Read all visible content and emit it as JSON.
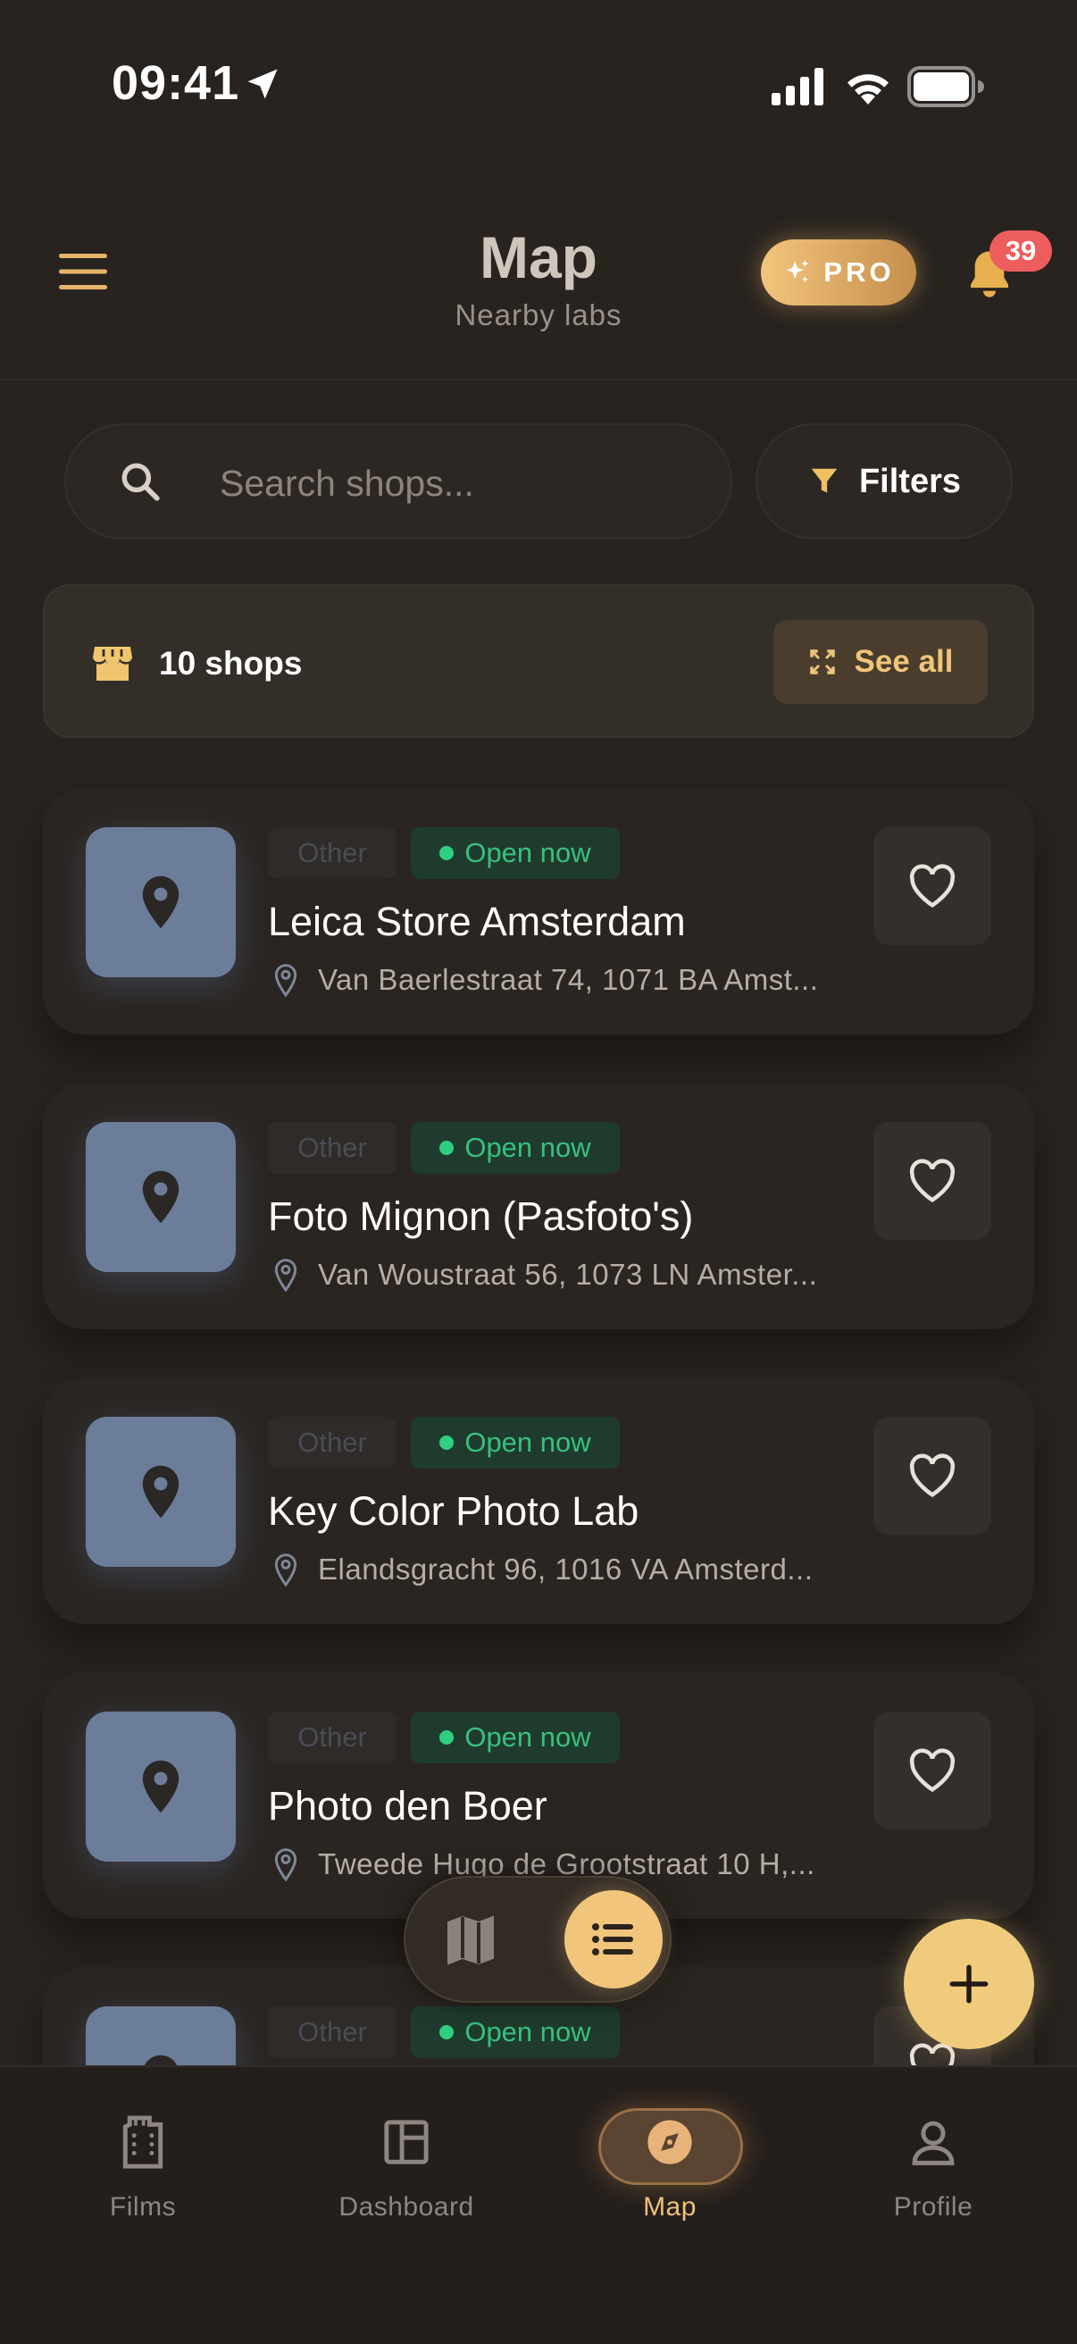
{
  "status_bar": {
    "time": "09:41"
  },
  "header": {
    "title": "Map",
    "subtitle": "Nearby labs",
    "pro_label": "PRO",
    "notification_count": "39"
  },
  "search": {
    "placeholder": "Search shops...",
    "value": ""
  },
  "filters_label": "Filters",
  "summary": {
    "count_label": "10 shops",
    "see_all_label": "See all"
  },
  "shops": [
    {
      "category": "Other",
      "status": "Open now",
      "name": "Leica Store Amsterdam",
      "address": "Van Baerlestraat 74, 1071 BA Amst..."
    },
    {
      "category": "Other",
      "status": "Open now",
      "name": "Foto Mignon (Pasfoto's)",
      "address": "Van Woustraat 56, 1073 LN Amster..."
    },
    {
      "category": "Other",
      "status": "Open now",
      "name": "Key Color Photo Lab",
      "address": "Elandsgracht 96, 1016 VA Amsterd..."
    },
    {
      "category": "Other",
      "status": "Open now",
      "name": "Photo den Boer",
      "address": "Tweede Hugo de Grootstraat 10 H,..."
    },
    {
      "category": "Other",
      "status": "Open now",
      "name": "",
      "address": ""
    }
  ],
  "nav": {
    "films": "Films",
    "dashboard": "Dashboard",
    "map": "Map",
    "profile": "Profile"
  },
  "colors": {
    "background": "#28231f",
    "accent": "#f2c57c",
    "open_green": "#38c07e",
    "badge_red": "#ee5d5d"
  }
}
